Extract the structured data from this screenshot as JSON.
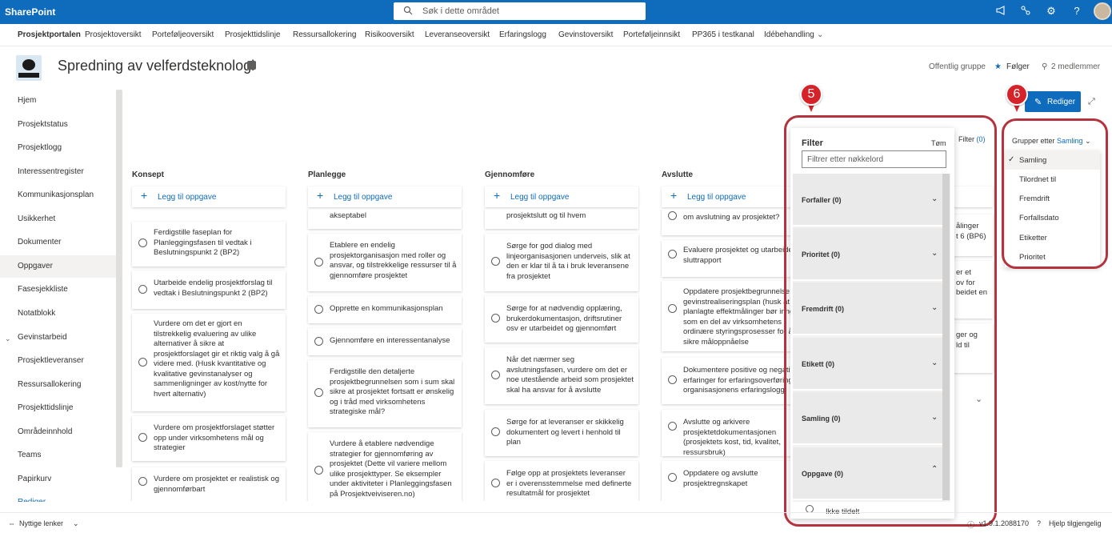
{
  "suite": {
    "brand": "SharePoint",
    "search_placeholder": "Søk i dette området"
  },
  "hubnav": [
    "Prosjektportalen",
    "Prosjektoversikt",
    "Porteføljeoversikt",
    "Prosjekttidslinje",
    "Ressursallokering",
    "Risikooversikt",
    "Leveranseoversikt",
    "Erfaringslogg",
    "Gevinstoversikt",
    "Porteføljeinnsikt",
    "PP365 i testkanal",
    "Idébehandling"
  ],
  "site": {
    "title": "Spredning av velferdsteknologi",
    "group": "Offentlig gruppe",
    "follow": "Følger",
    "members": "2 medlemmer"
  },
  "leftnav": [
    "Hjem",
    "Prosjektstatus",
    "Prosjektlogg",
    "Interessentregister",
    "Kommunikasjonsplan",
    "Usikkerhet",
    "Dokumenter",
    "Oppgaver",
    "Fasesjekkliste",
    "Notatblokk",
    "Gevinstarbeid",
    "Prosjektleveranser",
    "Ressursallokering",
    "Prosjekttidslinje",
    "Områdeinnhold",
    "Teams",
    "Papirkurv",
    "Rediger"
  ],
  "toolbar": {
    "edit": "Rediger",
    "filter_label": "Filter",
    "filter_count": "(0)",
    "group_by_label": "Grupper etter",
    "group_by_value": "Samling"
  },
  "columns": [
    {
      "title": "Konsept",
      "add": "Legg til oppgave",
      "cards": [
        "Ferdigstille faseplan for Planleggingsfasen til vedtak i Beslutningspunkt 2 (BP2)",
        "Utarbeide endelig prosjektforslag til vedtak i Beslutningspunkt 2 (BP2)",
        "Vurdere om det er gjort en tilstrekkelig evaluering av ulike alternativer å sikre at prosjektforslaget gir et riktig valg å gå videre med. (Husk kvantitative og kvalitative gevinstanalyser og sammenligninger av kost/nytte for hvert alternativ)",
        "Vurdere om prosjektforslaget støtter opp under virksomhetens mål og strategier",
        "Vurdere om prosjektet er realistisk og gjennomførbart"
      ]
    },
    {
      "title": "Planlegge",
      "add": "Legg til oppgave",
      "cards": [
        "akseptabel",
        "Etablere en endelig prosjektorganisasjon med roller og ansvar, og tilstrekkelige ressurser til å gjennomføre prosjektet",
        "Opprette en kommunikasjonsplan",
        "Gjennomføre en interessentanalyse",
        "Ferdigstille den detaljerte prosjektbegrunnelsen som i sum skal sikre at prosjektet fortsatt er ønskelig og i tråd med virksomhetens strategiske mål?",
        "Vurdere å etablere nødvendige strategier for gjennomføring av prosjektet (Dette vil variere mellom ulike prosjekttyper. Se eksempler under aktiviteter i Planleggingsfasen på Prosjektveiviseren.no)"
      ]
    },
    {
      "title": "Gjennomføre",
      "add": "Legg til oppgave",
      "cards": [
        "prosjektslutt og til hvem",
        "Sørge for god dialog med linjeorganisasjonen underveis, slik at den er klar til å ta i bruk leveransene fra prosjektet",
        "Sørge for at nødvendig opplæring, brukerdokumentasjon, driftsrutiner osv er utarbeidet og gjennomført",
        "Når det nærmer seg avslutningsfasen, vurdere om det er noe utestående arbeid som prosjektet skal ha ansvar for å avslutte",
        "Sørge for at leveranser er skikkelig dokumentert og levert i henhold til plan",
        "Følge opp at prosjektets leveranser er i overensstemmelse med definerte resultatmål for prosjektet"
      ]
    },
    {
      "title": "Avslutte",
      "add": "Legg til oppgave",
      "cards": [
        "om avslutning av prosjektet?",
        "Evaluere prosjektet og utarbeide sluttrapport",
        "Oppdatere prosjektbegrunnelse og gevinstrealiseringsplan (husk at planlagte effektmålinger bør inngå som en del av virksomhetens ordinære styringsprosesser for å sikre måloppnåelse",
        "Dokumentere positive og negative erfaringer for erfaringsoverføring til organisasjonens erfaringslogg",
        "Avslutte og arkivere prosjektetdokumentasjonen (prosjektets kost, tid, kvalitet, ressursbruk)",
        "Oppdatere og avslutte prosjektregnskapet"
      ]
    }
  ],
  "partial_column": [
    "ålinger\nt 6 (BP6)",
    "er et\nov for\nbeidet en",
    "ger og\nld til"
  ],
  "filter_panel": {
    "title": "Filter",
    "clear": "Tøm",
    "input_placeholder": "Filtrer etter nøkkelord",
    "sections": [
      {
        "label": "Forfaller (0)",
        "open": false
      },
      {
        "label": "Prioritet (0)",
        "open": false
      },
      {
        "label": "Fremdrift (0)",
        "open": false
      },
      {
        "label": "Etikett (0)",
        "open": false
      },
      {
        "label": "Samling (0)",
        "open": false
      },
      {
        "label": "Oppgave (0)",
        "open": true
      }
    ],
    "bottom_item": "Ikke tildelt"
  },
  "group_menu": {
    "options": [
      "Samling",
      "Tilordnet til",
      "Fremdrift",
      "Forfallsdato",
      "Etiketter",
      "Prioritet"
    ],
    "selected": "Samling"
  },
  "callouts": [
    "5",
    "6"
  ],
  "footer": {
    "links": "Nyttige lenker",
    "version": "v1.9.1.2088170",
    "accessibility": "Hjelp tilgjengelig"
  },
  "colors": {
    "brand": "#0f6cbd",
    "callout": "#d6232a",
    "highlight": "#b5333e"
  }
}
